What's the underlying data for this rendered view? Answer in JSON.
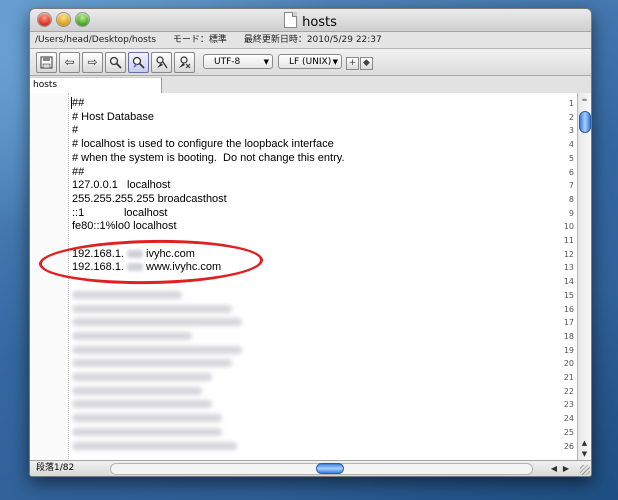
{
  "window": {
    "title": "hosts",
    "file_path": "/Users/head/Desktop/hosts",
    "mode": "モード：標準",
    "last_modified": "最終更新日時：2010/5/29 22:37"
  },
  "toolbar": {
    "encoding": "UTF-8",
    "line_ending": "LF (UNIX)",
    "icons": [
      "save-icon",
      "back-icon",
      "forward-icon",
      "find-icon",
      "find-replace-icon",
      "tools-icon",
      "script-icon",
      "plus-icon",
      "diamond-icon"
    ]
  },
  "tab": {
    "label": "hosts"
  },
  "editor": {
    "lines": [
      {
        "no": "1",
        "text": "##"
      },
      {
        "no": "2",
        "text": "# Host Database"
      },
      {
        "no": "3",
        "text": "#"
      },
      {
        "no": "4",
        "text": "# localhost is used to configure the loopback interface"
      },
      {
        "no": "5",
        "text": "# when the system is booting.  Do not change this entry."
      },
      {
        "no": "6",
        "text": "##"
      },
      {
        "no": "7",
        "text": "127.0.0.1   localhost"
      },
      {
        "no": "8",
        "text": "255.255.255.255 broadcasthost"
      },
      {
        "no": "9",
        "text": "::1             localhost"
      },
      {
        "no": "10",
        "text": "fe80::1%lo0 localhost"
      },
      {
        "no": "11",
        "text": ""
      },
      {
        "no": "12",
        "text": "192.168.1.",
        "after": "ivyhc.com"
      },
      {
        "no": "13",
        "text": "192.168.1.",
        "after": "www.ivyhc.com"
      },
      {
        "no": "14",
        "text": ""
      },
      {
        "no": "15",
        "text": ""
      },
      {
        "no": "16",
        "text": ""
      },
      {
        "no": "17",
        "text": ""
      },
      {
        "no": "18",
        "text": ""
      },
      {
        "no": "19",
        "text": ""
      },
      {
        "no": "20",
        "text": ""
      },
      {
        "no": "21",
        "text": ""
      },
      {
        "no": "22",
        "text": ""
      },
      {
        "no": "23",
        "text": ""
      },
      {
        "no": "24",
        "text": ""
      },
      {
        "no": "25",
        "text": ""
      },
      {
        "no": "26",
        "text": ""
      }
    ]
  },
  "statusbar": {
    "text": "段落1/82"
  },
  "colors": {
    "annotation": "#e02020",
    "scroll_thumb": "#3a7fd9"
  }
}
